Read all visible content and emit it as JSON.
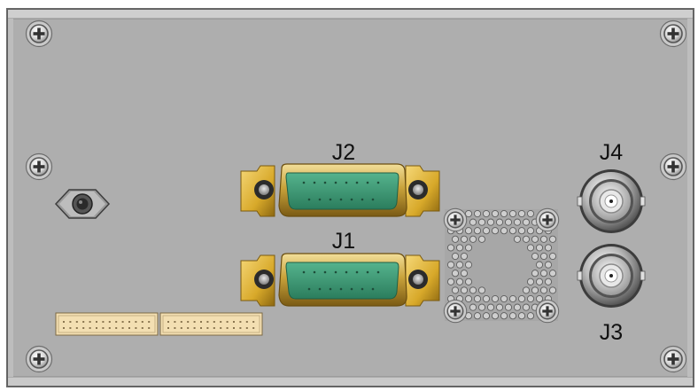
{
  "panel": {
    "body_color": "#aeaeae",
    "edge_color": "#555555",
    "header_color": "#c8c8c8"
  },
  "connectors": {
    "j2": {
      "label": "J2",
      "type": "DB-15 D-sub",
      "pins": 15
    },
    "j1": {
      "label": "J1",
      "type": "DB-15 D-sub",
      "pins": 15
    },
    "j4": {
      "label": "J4",
      "type": "BNC"
    },
    "j3": {
      "label": "J3",
      "type": "BNC"
    }
  },
  "colors": {
    "dsub_insulator": "#3a9a74",
    "dsub_shell": "#c9a33b",
    "bracket": "#d8a92a",
    "header_strip": "#f3dfb2"
  },
  "icons": {
    "mount_screw": "phillips-screw-icon",
    "power_jack": "power-jack-icon",
    "vent": "ventilation-grille-icon"
  }
}
